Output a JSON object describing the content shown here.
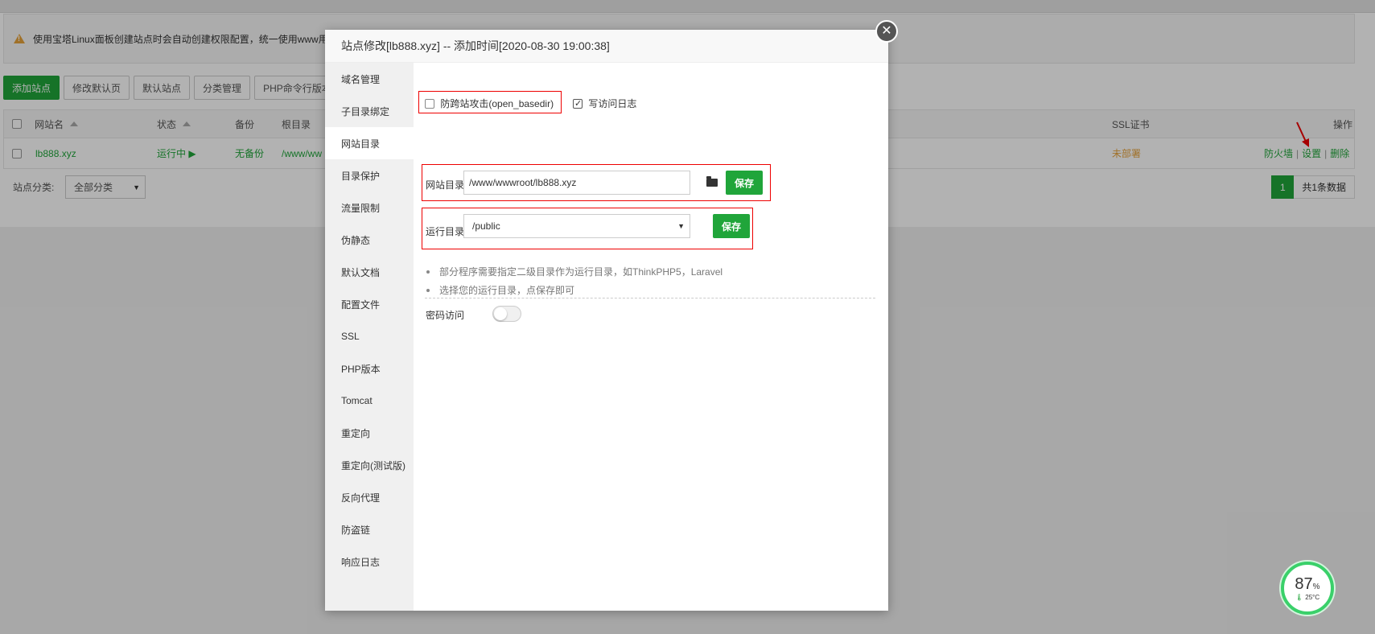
{
  "notice": {
    "text": "使用宝塔Linux面板创建站点时会自动创建权限配置，统一使用www用"
  },
  "toolbar": {
    "buttons": [
      "添加站点",
      "修改默认页",
      "默认站点",
      "分类管理",
      "PHP命令行版本"
    ]
  },
  "table": {
    "headers": {
      "name": "网站名",
      "status": "状态",
      "backup": "备份",
      "root": "根目录",
      "ssl": "SSL证书",
      "ops": "操作"
    },
    "row": {
      "name": "lb888.xyz",
      "status": "运行中 ▶",
      "backup": "无备份",
      "root": "/www/ww",
      "ssl": "未部署",
      "ops": [
        "防火墙",
        "设置",
        "删除"
      ]
    }
  },
  "footer": {
    "category_label": "站点分类:",
    "category_value": "全部分类",
    "page": "1",
    "total": "共1条数据"
  },
  "modal": {
    "title": "站点修改[lb888.xyz] -- 添加时间[2020-08-30 19:00:38]",
    "sidebar": [
      "域名管理",
      "子目录绑定",
      "网站目录",
      "目录保护",
      "流量限制",
      "伪静态",
      "默认文档",
      "配置文件",
      "SSL",
      "PHP版本",
      "Tomcat",
      "重定向",
      "重定向(测试版)",
      "反向代理",
      "防盗链",
      "响应日志"
    ],
    "active_index": 2,
    "open_basedir_label": "防跨站攻击(open_basedir)",
    "access_log_label": "写访问日志",
    "site_dir_label": "网站目录",
    "site_dir_value": "/www/wwwroot/lb888.xyz",
    "run_dir_label": "运行目录",
    "run_dir_value": "/public",
    "save_label": "保存",
    "tips": [
      "部分程序需要指定二级目录作为运行目录，如ThinkPHP5，Laravel",
      "选择您的运行目录，点保存即可"
    ],
    "password_access_label": "密码访问"
  },
  "gauge": {
    "value": "87",
    "unit": "%",
    "temp": "25°C"
  },
  "colors": {
    "accent": "#20a53a",
    "warning": "#e6a23c",
    "highlight": "#e00000"
  }
}
